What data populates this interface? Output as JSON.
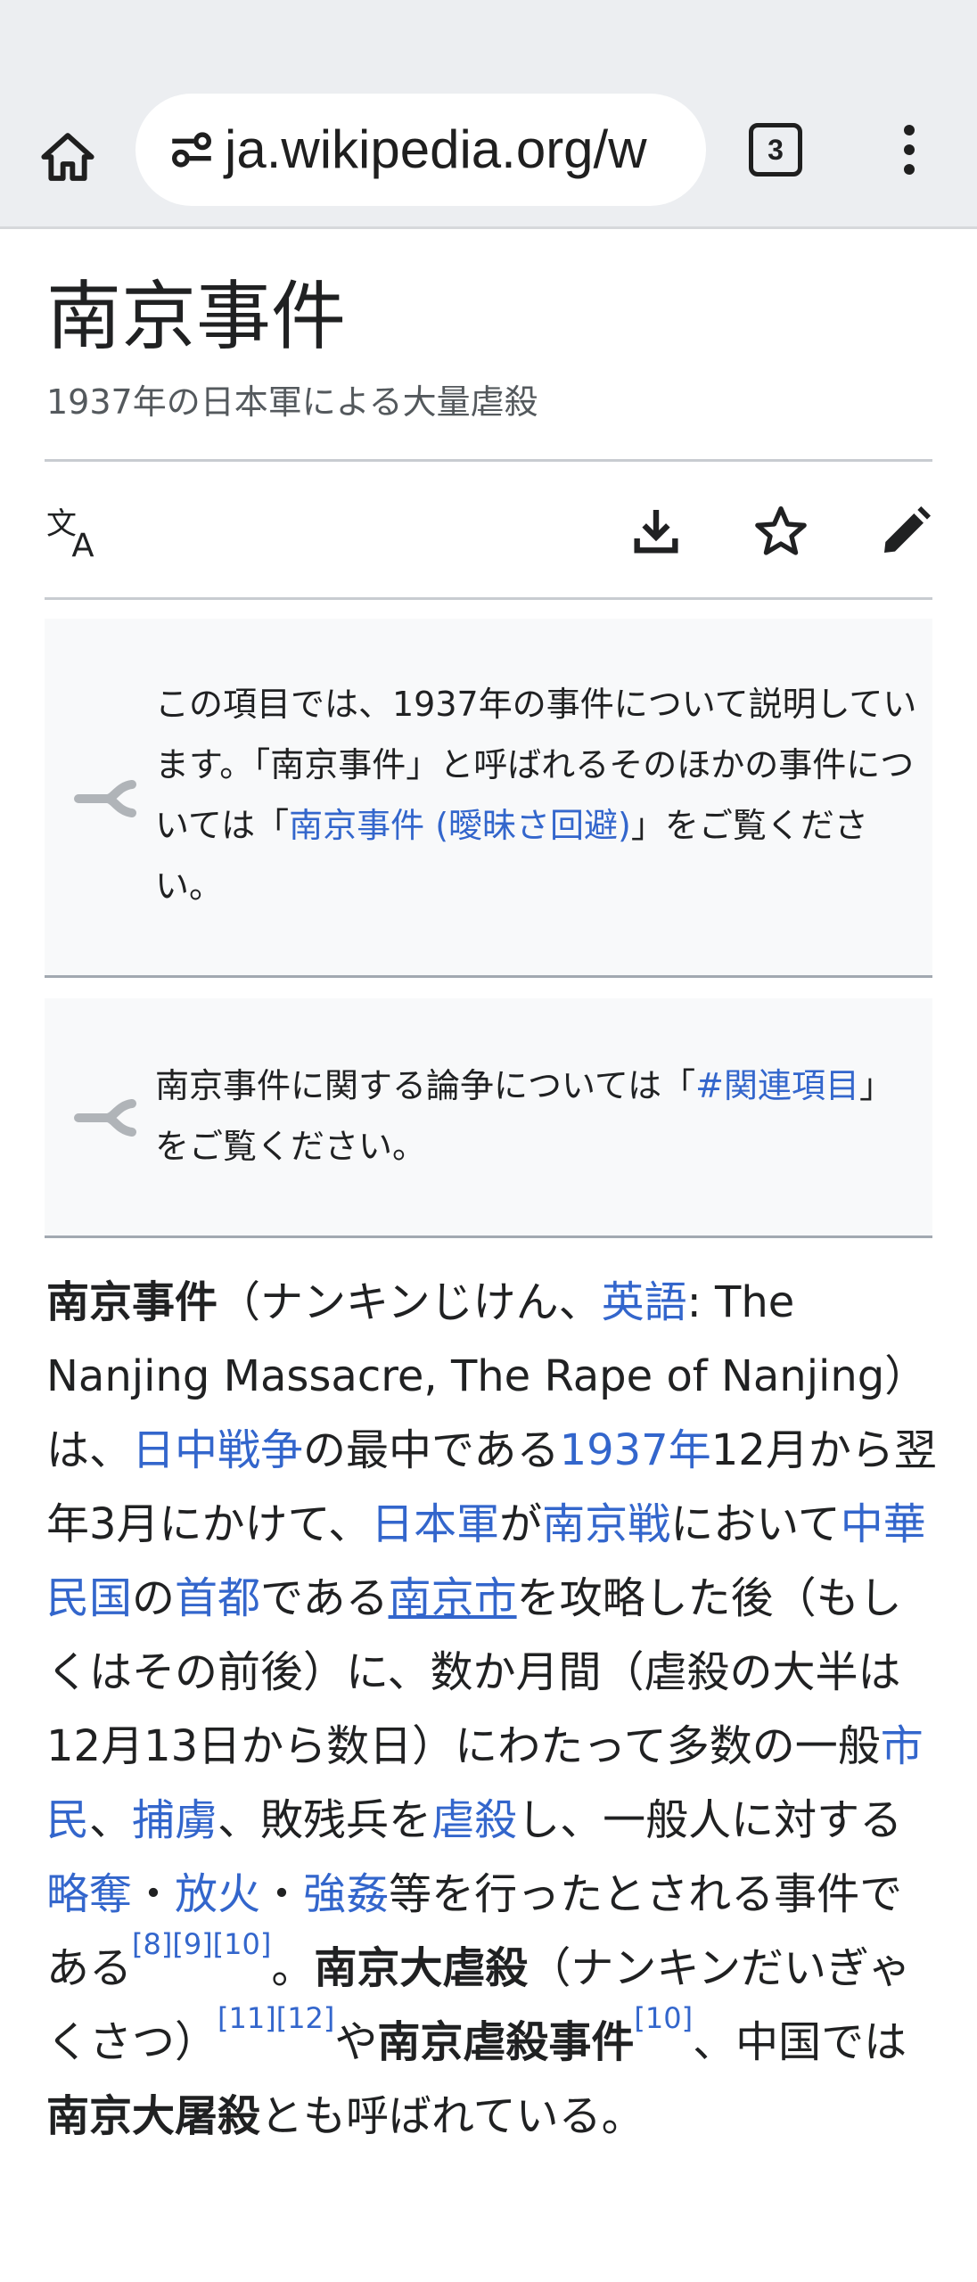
{
  "browser": {
    "url": "ja.wikipedia.org/w",
    "tab_count": "3"
  },
  "article": {
    "title": "南京事件",
    "subtitle": "1937年の日本軍による大量虐殺"
  },
  "hatnote1": {
    "t1": "この項目では、1937年の事件について説明しています。「南京事件」と呼ばれるそのほかの事件については「",
    "link": "南京事件 (曖昧さ回避)",
    "t2": "」をご覧ください。"
  },
  "hatnote2": {
    "t1": "南京事件に関する論争については「",
    "link": "#関連項目",
    "t2": "」をご覧ください。"
  },
  "lead": {
    "b1": "南京事件",
    "t1": "（ナンキンじけん、",
    "l_english": "英語",
    "t2": ": The Nanjing Massacre, The Rape of Nanjing）は、",
    "l_war": "日中戦争",
    "t3": "の最中である",
    "l_1937": "1937年",
    "t4": "12月から翌年3月にかけて、",
    "l_army": "日本軍",
    "t5": "が",
    "l_battle": "南京戦",
    "t6": "において",
    "l_roc": "中華民国",
    "t7": "の",
    "l_capital": "首都",
    "t8": "である",
    "l_city": "南京市",
    "t9": "を攻略した後（もしくはその前後）に、数か月間（虐殺の大半は12月13日から数日）にわたって多数の一般",
    "l_citizens": "市民",
    "t10": "、",
    "l_pow": "捕虜",
    "t11": "、敗残兵を",
    "l_massacre": "虐殺",
    "t12": "し、一般人に対する",
    "l_looting": "略奪",
    "t13": "・",
    "l_arson": "放火",
    "t14": "・",
    "l_rape": "強姦",
    "t15": "等を行ったとされる事件である",
    "ref8": "[8]",
    "ref9": "[9]",
    "ref10": "[10]",
    "t16": "。",
    "b2": "南京大虐殺",
    "t17": "（ナンキンだいぎゃくさつ）",
    "ref11": "[11]",
    "ref12": "[12]",
    "t18": "や",
    "b3": "南京虐殺事件",
    "ref10b": "[10]",
    "t19": "、中国では",
    "b4": "南京大屠殺",
    "t20": "とも呼ばれている。"
  },
  "icons": [
    "home-icon",
    "site-info-icon",
    "tab-switcher-icon",
    "overflow-menu-icon",
    "translate-icon",
    "download-icon",
    "star-icon",
    "edit-icon",
    "disambiguation-icon"
  ]
}
